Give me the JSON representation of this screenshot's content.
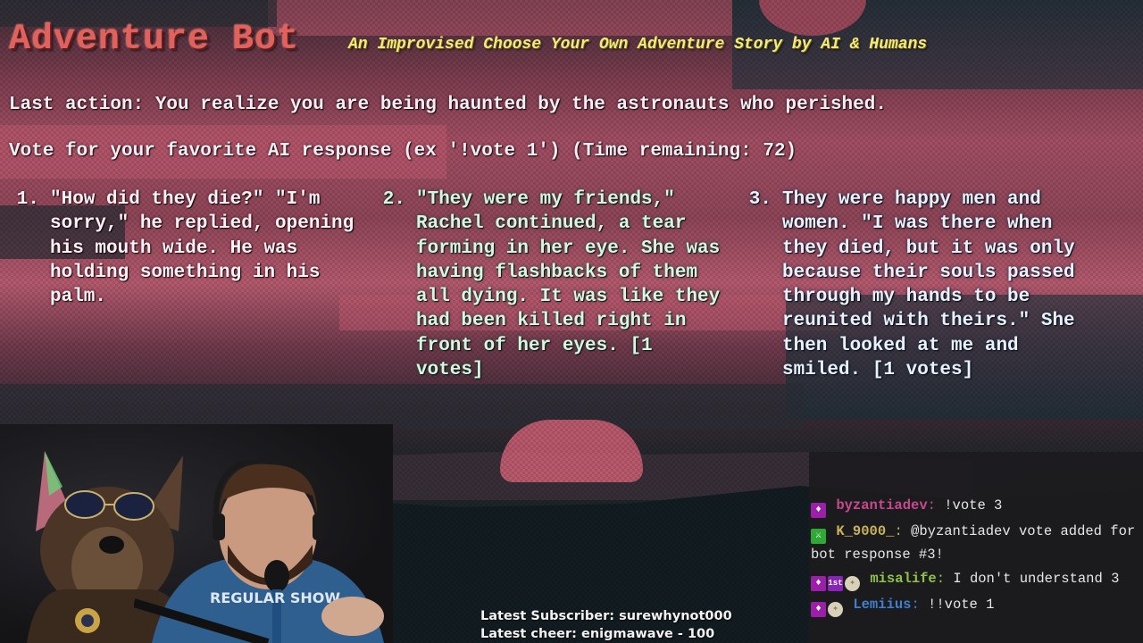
{
  "header": {
    "title": "Adventure Bot",
    "subtitle": "An Improvised Choose Your Own Adventure Story by AI & Humans"
  },
  "story": {
    "last_action": "Last action: You realize you are being haunted by the astronauts who perished.",
    "vote_prompt": "Vote for your favorite AI response (ex '!vote 1') (Time remaining: 72)",
    "time_remaining": 72,
    "options": [
      {
        "number": "1.",
        "text": "\"How did they die?\" \"I'm sorry,\" he replied, opening his mouth wide. He was holding something in his palm.",
        "votes": null
      },
      {
        "number": "2.",
        "text": "\"They were my friends,\" Rachel continued, a tear forming in her eye. She was having flashbacks of them all dying. It was like they had been killed right in front of her eyes. [1 votes]",
        "votes": 1
      },
      {
        "number": "3.",
        "text": "They were happy men and women. \"I was there when they died, but it was only because their souls passed through my hands to be reunited with theirs.\" She then looked at me and smiled. [1 votes]",
        "votes": 1
      }
    ]
  },
  "overlay": {
    "latest_subscriber": "Latest Subscriber: surewhynot000",
    "latest_cheer": "Latest cheer: enigmawave - 100"
  },
  "webcam": {
    "shirt_text": "REGULAR SHOW"
  },
  "chat": {
    "messages": [
      {
        "badges": [
          "subscriber-icon"
        ],
        "user": "byzantiadev",
        "user_color": "#c8488f",
        "text": "!vote 3"
      },
      {
        "badges": [
          "moderator-sword-icon"
        ],
        "user": "K_9000_",
        "user_color": "#c9b25a",
        "text": "@byzantiadev vote added for bot response #3!"
      },
      {
        "badges": [
          "subscriber-icon",
          "first-badge-icon",
          "coin-badge-icon"
        ],
        "user": "misalife",
        "user_color": "#8fc24a",
        "text": "I don't understand 3"
      },
      {
        "badges": [
          "subscriber-icon",
          "coin-badge-icon"
        ],
        "user": "Lemiius",
        "user_color": "#3f7fd0",
        "text": "!!vote 1"
      }
    ],
    "first_badge_label": "1st"
  },
  "colors": {
    "title": "#e2615b",
    "subtitle": "#f2ea7a",
    "option1_text": "#fbf2f6",
    "option2_text": "#d7f6e2",
    "option3_text": "#e9f2fb",
    "chat_bg": "#1c1b1e"
  }
}
